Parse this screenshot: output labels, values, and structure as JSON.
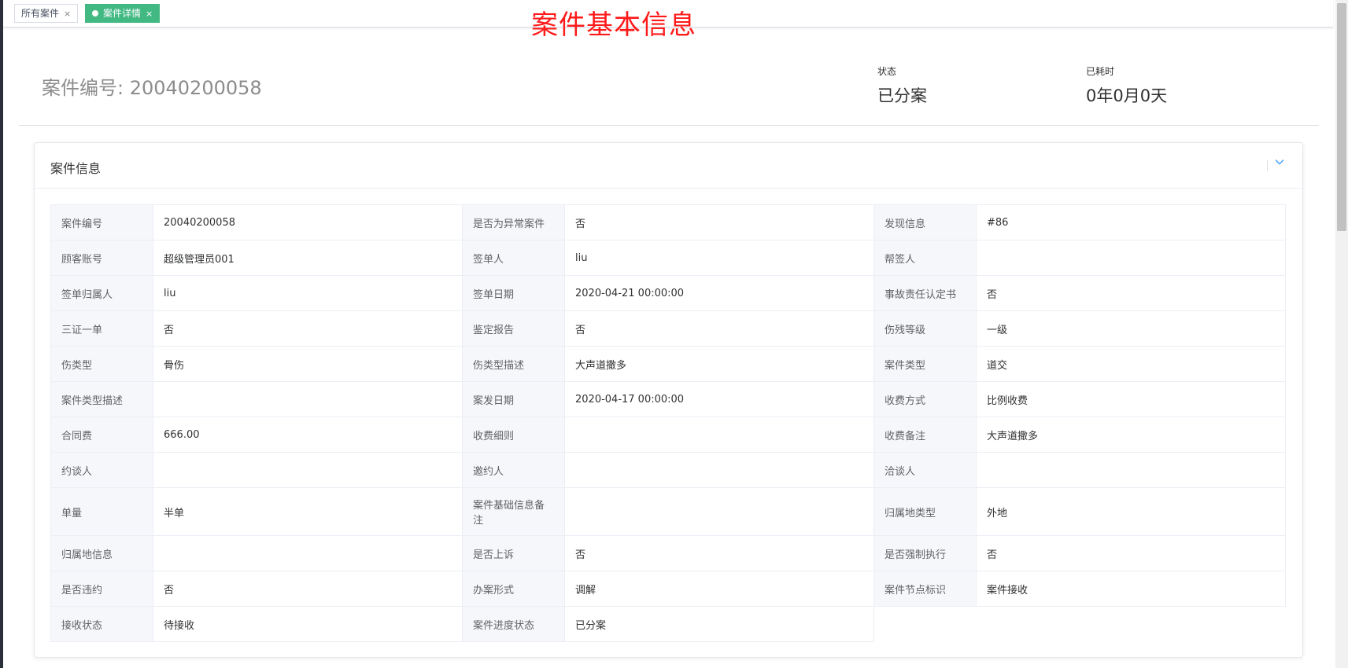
{
  "tabs": [
    {
      "label": "所有案件",
      "close": "×",
      "active": false
    },
    {
      "label": "案件详情",
      "close": "×",
      "active": true
    }
  ],
  "annotation": "案件基本信息",
  "header": {
    "case_number": "案件编号: 20040200058",
    "status_label": "状态",
    "status_value": "已分案",
    "elapsed_label": "已耗时",
    "elapsed_value": "0年0月0天"
  },
  "card": {
    "title": "案件信息",
    "collapse_icon": "chevron-down-icon"
  },
  "rows": [
    [
      [
        "案件编号",
        "20040200058"
      ],
      [
        "是否为异常案件",
        "否"
      ],
      [
        "发现信息",
        "#86"
      ]
    ],
    [
      [
        "顾客账号",
        "超级管理员001"
      ],
      [
        "签单人",
        "liu"
      ],
      [
        "帮签人",
        ""
      ]
    ],
    [
      [
        "签单归属人",
        "liu"
      ],
      [
        "签单日期",
        "2020-04-21 00:00:00"
      ],
      [
        "事故责任认定书",
        "否"
      ]
    ],
    [
      [
        "三证一单",
        "否"
      ],
      [
        "鉴定报告",
        "否"
      ],
      [
        "伤残等级",
        "一级"
      ]
    ],
    [
      [
        "伤类型",
        "骨伤"
      ],
      [
        "伤类型描述",
        "大声道撒多"
      ],
      [
        "案件类型",
        "道交"
      ]
    ],
    [
      [
        "案件类型描述",
        ""
      ],
      [
        "案发日期",
        "2020-04-17 00:00:00"
      ],
      [
        "收费方式",
        "比例收费"
      ]
    ],
    [
      [
        "合同费",
        "666.00"
      ],
      [
        "收费细则",
        ""
      ],
      [
        "收费备注",
        "大声道撒多"
      ]
    ],
    [
      [
        "约谈人",
        ""
      ],
      [
        "邀约人",
        ""
      ],
      [
        "洽谈人",
        ""
      ]
    ],
    [
      [
        "单量",
        "半单"
      ],
      [
        "案件基础信息备注",
        ""
      ],
      [
        "归属地类型",
        "外地"
      ]
    ],
    [
      [
        "归属地信息",
        ""
      ],
      [
        "是否上诉",
        "否"
      ],
      [
        "是否强制执行",
        "否"
      ]
    ],
    [
      [
        "是否违约",
        "否"
      ],
      [
        "办案形式",
        "调解"
      ],
      [
        "案件节点标识",
        "案件接收"
      ]
    ],
    [
      [
        "接收状态",
        "待接收"
      ],
      [
        "案件进度状态",
        "已分案"
      ]
    ]
  ],
  "colors": {
    "active_tab": "#42b983",
    "annotation": "#ff1a1a",
    "label_bg": "#f5f7fa",
    "accent": "#409eff"
  }
}
